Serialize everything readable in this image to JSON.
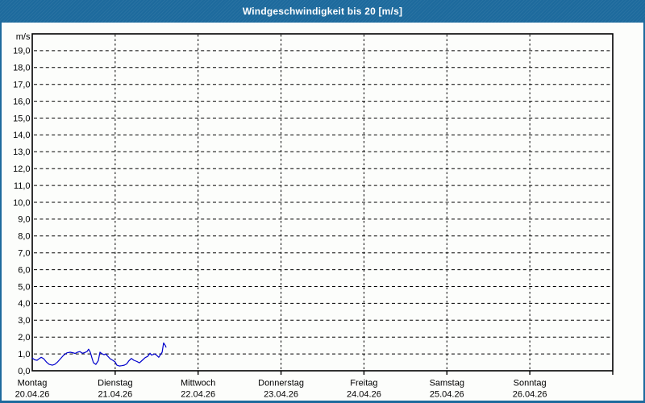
{
  "window": {
    "title": "Windgeschwindigkeit bis 20 [m/s]"
  },
  "colors": {
    "frame_blue": "#1d6a9d",
    "plot_background": "#fcfdfb",
    "grid_black": "#000000",
    "series_blue": "#0000cc",
    "title_text": "#ffffff"
  },
  "chart_data": {
    "type": "line",
    "title": "Windgeschwindigkeit bis 20 [m/s]",
    "unit_label": "m/s",
    "xlabel": "",
    "ylabel": "m/s",
    "ylim": [
      0,
      20
    ],
    "y_tick_step": 1.0,
    "y_tick_labels_top_to_bottom": [
      "19,0",
      "18,0",
      "17,0",
      "16,0",
      "15,0",
      "14,0",
      "13,0",
      "12,0",
      "11,0",
      "10,0",
      "9,0",
      "8,0",
      "7,0",
      "6,0",
      "5,0",
      "4,0",
      "3,0",
      "2,0",
      "1,0",
      "0,0"
    ],
    "x_axis_days": [
      {
        "name": "Montag",
        "date": "20.04.26"
      },
      {
        "name": "Dienstag",
        "date": "21.04.26"
      },
      {
        "name": "Mittwoch",
        "date": "22.04.26"
      },
      {
        "name": "Donnerstag",
        "date": "23.04.26"
      },
      {
        "name": "Freitag",
        "date": "24.04.26"
      },
      {
        "name": "Samstag",
        "date": "25.04.26"
      },
      {
        "name": "Sonntag",
        "date": "26.04.26"
      }
    ],
    "x_total_hours": 168,
    "grid": true,
    "legend": "none",
    "series": [
      {
        "name": "Windgeschwindigkeit",
        "color": "#0000cc",
        "points_t_hours_v_ms": [
          [
            0.0,
            0.75
          ],
          [
            0.7,
            0.65
          ],
          [
            1.4,
            0.62
          ],
          [
            2.1,
            0.73
          ],
          [
            2.6,
            0.8
          ],
          [
            3.3,
            0.72
          ],
          [
            4.2,
            0.5
          ],
          [
            4.9,
            0.38
          ],
          [
            5.8,
            0.33
          ],
          [
            6.5,
            0.38
          ],
          [
            7.2,
            0.5
          ],
          [
            8.2,
            0.72
          ],
          [
            9.1,
            0.93
          ],
          [
            10.0,
            1.06
          ],
          [
            11.0,
            1.1
          ],
          [
            11.7,
            1.07
          ],
          [
            12.4,
            1.03
          ],
          [
            13.1,
            1.1
          ],
          [
            13.8,
            1.14
          ],
          [
            14.5,
            1.04
          ],
          [
            15.2,
            1.08
          ],
          [
            15.9,
            1.15
          ],
          [
            16.3,
            1.28
          ],
          [
            16.8,
            1.1
          ],
          [
            17.3,
            0.75
          ],
          [
            17.7,
            0.48
          ],
          [
            18.4,
            0.38
          ],
          [
            19.1,
            0.6
          ],
          [
            19.6,
            1.1
          ],
          [
            20.1,
            1.02
          ],
          [
            20.8,
            0.95
          ],
          [
            21.2,
            1.0
          ],
          [
            21.9,
            0.85
          ],
          [
            22.6,
            0.7
          ],
          [
            23.3,
            0.62
          ],
          [
            24.0,
            0.52
          ],
          [
            24.5,
            0.33
          ],
          [
            25.2,
            0.28
          ],
          [
            25.9,
            0.3
          ],
          [
            26.6,
            0.33
          ],
          [
            27.3,
            0.4
          ],
          [
            28.0,
            0.6
          ],
          [
            28.7,
            0.73
          ],
          [
            29.4,
            0.62
          ],
          [
            30.3,
            0.55
          ],
          [
            31.0,
            0.47
          ],
          [
            31.7,
            0.6
          ],
          [
            32.7,
            0.78
          ],
          [
            33.4,
            0.85
          ],
          [
            34.1,
            1.04
          ],
          [
            34.5,
            0.93
          ],
          [
            35.5,
            1.0
          ],
          [
            36.2,
            0.88
          ],
          [
            36.6,
            0.8
          ],
          [
            37.1,
            0.95
          ],
          [
            37.6,
            1.1
          ],
          [
            38.0,
            1.65
          ],
          [
            38.5,
            1.5
          ],
          [
            38.7,
            1.4
          ]
        ]
      }
    ]
  }
}
